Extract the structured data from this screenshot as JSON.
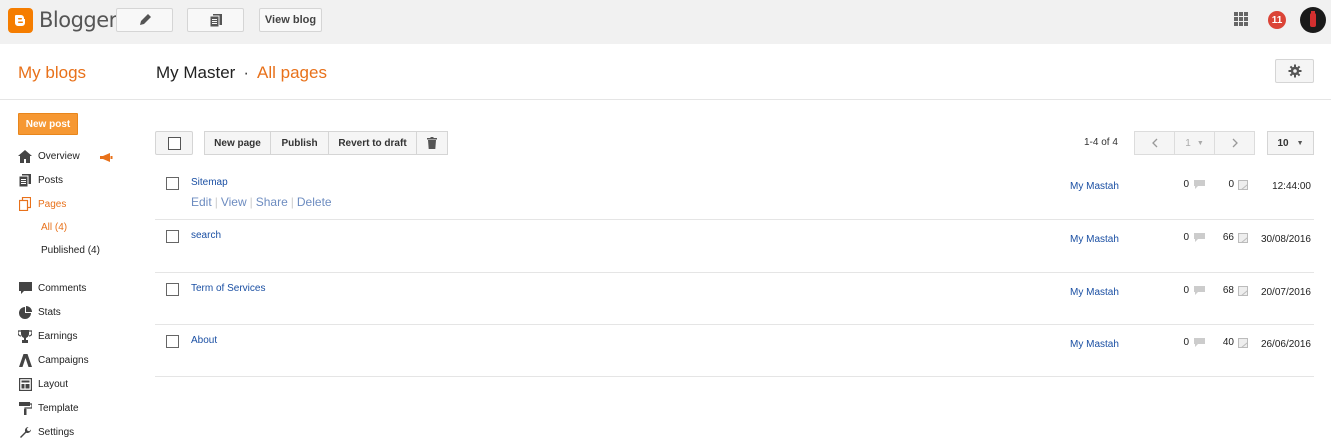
{
  "topbar": {
    "app_name": "Blogger",
    "view_blog": "View blog",
    "notifications": "11"
  },
  "header": {
    "my_blogs": "My blogs",
    "blog_name": "My Master",
    "separator": "·",
    "crumb": "All pages"
  },
  "sidebar": {
    "new_post": "New post",
    "items": [
      {
        "label": "Overview",
        "icon": "home-icon"
      },
      {
        "label": "Posts",
        "icon": "posts-icon"
      },
      {
        "label": "Pages",
        "icon": "pages-icon"
      },
      {
        "label": "Comments",
        "icon": "comment-icon"
      },
      {
        "label": "Stats",
        "icon": "pie-chart-icon"
      },
      {
        "label": "Earnings",
        "icon": "trophy-icon"
      },
      {
        "label": "Campaigns",
        "icon": "campaigns-icon"
      },
      {
        "label": "Layout",
        "icon": "layout-icon"
      },
      {
        "label": "Template",
        "icon": "paint-roller-icon"
      },
      {
        "label": "Settings",
        "icon": "wrench-icon"
      }
    ],
    "sub_items": [
      {
        "label": "All (4)"
      },
      {
        "label": "Published (4)"
      }
    ]
  },
  "toolbar": {
    "new_page": "New page",
    "publish": "Publish",
    "revert": "Revert to draft",
    "page_info": "1-4 of 4",
    "page_number": "1",
    "per_page": "10"
  },
  "row_actions": {
    "edit": "Edit",
    "view": "View",
    "share": "Share",
    "delete": "Delete"
  },
  "rows": [
    {
      "title": "Sitemap",
      "author": "My Mastah",
      "comments": "0",
      "views": "0",
      "date": "12:44:00"
    },
    {
      "title": "search",
      "author": "My Mastah",
      "comments": "0",
      "views": "66",
      "date": "30/08/2016"
    },
    {
      "title": "Term of Services",
      "author": "My Mastah",
      "comments": "0",
      "views": "68",
      "date": "20/07/2016"
    },
    {
      "title": "About",
      "author": "My Mastah",
      "comments": "0",
      "views": "40",
      "date": "26/06/2016"
    }
  ],
  "colors": {
    "accent": "#e8711a",
    "brand": "#f57d00",
    "new_post_bg": "#f69833",
    "link": "#1a4fa3",
    "notif": "#db4437"
  }
}
